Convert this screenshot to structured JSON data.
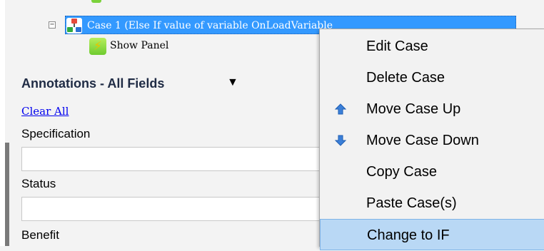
{
  "tree": {
    "case_label": "Case 1 (Else If value of variable OnLoadVariable",
    "action_label": "Show Panel",
    "expander_glyph": "−"
  },
  "annotations": {
    "title": "Annotations - All Fields",
    "caret": "▼",
    "clear_all": "Clear All",
    "fields": [
      {
        "label": "Specification",
        "value": ""
      },
      {
        "label": "Status",
        "value": ""
      },
      {
        "label": "Benefit",
        "value": ""
      }
    ]
  },
  "context_menu": {
    "items": [
      {
        "label": "Edit Case",
        "icon": ""
      },
      {
        "label": "Delete Case",
        "icon": ""
      },
      {
        "label": "Move Case Up",
        "icon": "arrow-up-icon"
      },
      {
        "label": "Move Case Down",
        "icon": "arrow-down-icon"
      },
      {
        "label": "Copy Case",
        "icon": ""
      },
      {
        "label": "Paste Case(s)",
        "icon": ""
      },
      {
        "label": "Change to IF",
        "icon": "",
        "highlighted": true
      }
    ]
  },
  "colors": {
    "selection": "#3399ff",
    "menu_highlight": "#b9d8f5",
    "arrow_icon": "#3b7fd8",
    "link": "#0000ee"
  }
}
